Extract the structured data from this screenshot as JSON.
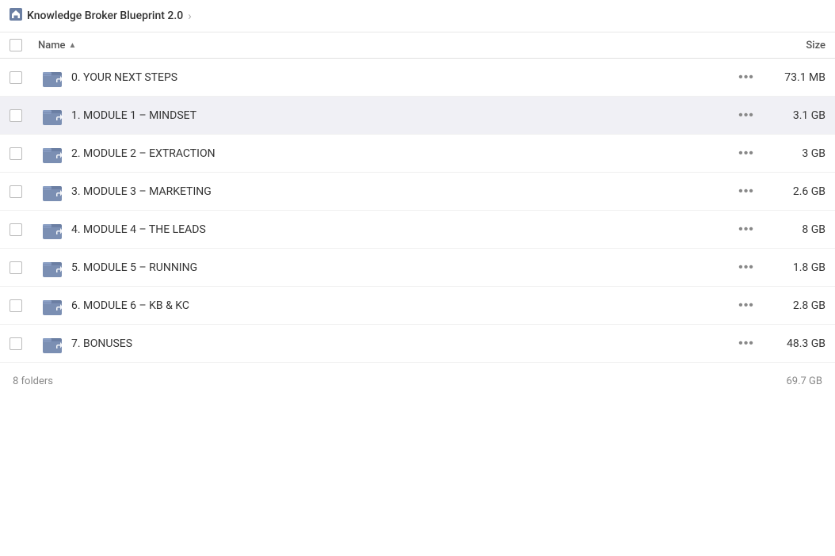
{
  "breadcrumb": {
    "icon": "🏠",
    "title": "Knowledge Broker Blueprint 2.0",
    "chevron": "›"
  },
  "table": {
    "col_name_label": "Name",
    "col_size_label": "Size",
    "sort_icon": "▲"
  },
  "files": [
    {
      "id": 1,
      "name": "0. YOUR NEXT STEPS",
      "size": "73.1 MB"
    },
    {
      "id": 2,
      "name": "1. MODULE 1 – MINDSET",
      "size": "3.1 GB"
    },
    {
      "id": 3,
      "name": "2. MODULE 2 – EXTRACTION",
      "size": "3 GB"
    },
    {
      "id": 4,
      "name": "3. MODULE 3 – MARKETING",
      "size": "2.6 GB"
    },
    {
      "id": 5,
      "name": "4. MODULE 4 – THE LEADS",
      "size": "8 GB"
    },
    {
      "id": 6,
      "name": "5. MODULE 5 – RUNNING",
      "size": "1.8 GB"
    },
    {
      "id": 7,
      "name": "6. MODULE 6 – KB & KC",
      "size": "2.8 GB"
    },
    {
      "id": 8,
      "name": "7. BONUSES",
      "size": "48.3 GB"
    }
  ],
  "footer": {
    "count": "8 folders",
    "total": "69.7 GB"
  },
  "dots_label": "•••"
}
